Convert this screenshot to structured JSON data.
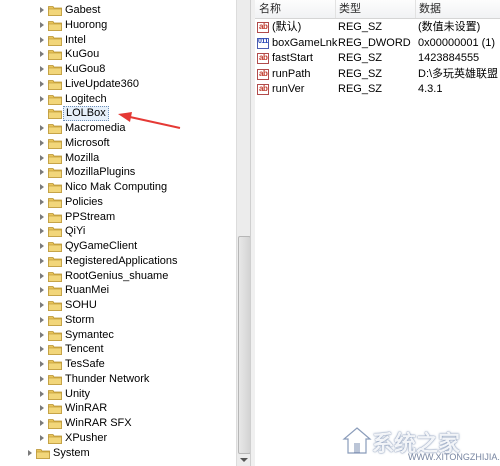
{
  "tree": {
    "items": [
      {
        "label": "Gabest",
        "indent": 1,
        "expander": true
      },
      {
        "label": "Huorong",
        "indent": 1,
        "expander": true
      },
      {
        "label": "Intel",
        "indent": 1,
        "expander": true
      },
      {
        "label": "KuGou",
        "indent": 1,
        "expander": true
      },
      {
        "label": "KuGou8",
        "indent": 1,
        "expander": true
      },
      {
        "label": "LiveUpdate360",
        "indent": 1,
        "expander": true
      },
      {
        "label": "Logitech",
        "indent": 1,
        "expander": true
      },
      {
        "label": "LOLBox",
        "indent": 1,
        "expander": false,
        "selected": true
      },
      {
        "label": "Macromedia",
        "indent": 1,
        "expander": true
      },
      {
        "label": "Microsoft",
        "indent": 1,
        "expander": true
      },
      {
        "label": "Mozilla",
        "indent": 1,
        "expander": true
      },
      {
        "label": "MozillaPlugins",
        "indent": 1,
        "expander": true
      },
      {
        "label": "Nico Mak Computing",
        "indent": 1,
        "expander": true
      },
      {
        "label": "Policies",
        "indent": 1,
        "expander": true
      },
      {
        "label": "PPStream",
        "indent": 1,
        "expander": true
      },
      {
        "label": "QiYi",
        "indent": 1,
        "expander": true
      },
      {
        "label": "QyGameClient",
        "indent": 1,
        "expander": true
      },
      {
        "label": "RegisteredApplications",
        "indent": 1,
        "expander": true
      },
      {
        "label": "RootGenius_shuame",
        "indent": 1,
        "expander": true
      },
      {
        "label": "RuanMei",
        "indent": 1,
        "expander": true
      },
      {
        "label": "SOHU",
        "indent": 1,
        "expander": true
      },
      {
        "label": "Storm",
        "indent": 1,
        "expander": true
      },
      {
        "label": "Symantec",
        "indent": 1,
        "expander": true
      },
      {
        "label": "Tencent",
        "indent": 1,
        "expander": true
      },
      {
        "label": "TesSafe",
        "indent": 1,
        "expander": true
      },
      {
        "label": "Thunder Network",
        "indent": 1,
        "expander": true
      },
      {
        "label": "Unity",
        "indent": 1,
        "expander": true
      },
      {
        "label": "WinRAR",
        "indent": 1,
        "expander": true
      },
      {
        "label": "WinRAR SFX",
        "indent": 1,
        "expander": true
      },
      {
        "label": "XPusher",
        "indent": 1,
        "expander": true
      },
      {
        "label": "System",
        "indent": 0,
        "expander": true
      }
    ]
  },
  "values": {
    "headers": {
      "name": "名称",
      "type": "类型",
      "data": "数据"
    },
    "rows": [
      {
        "icon": "string-value-icon",
        "name": "(默认)",
        "type": "REG_SZ",
        "data": "(数值未设置)"
      },
      {
        "icon": "binary-value-icon",
        "name": "boxGameLnk...",
        "type": "REG_DWORD",
        "data": "0x00000001 (1)"
      },
      {
        "icon": "string-value-icon",
        "name": "fastStart",
        "type": "REG_SZ",
        "data": "1423884555"
      },
      {
        "icon": "string-value-icon",
        "name": "runPath",
        "type": "REG_SZ",
        "data": "D:\\多玩英雄联盟盒子"
      },
      {
        "icon": "string-value-icon",
        "name": "runVer",
        "type": "REG_SZ",
        "data": "4.3.1"
      }
    ]
  },
  "colors": {
    "selection_border": "#6e8fb8",
    "annotation_arrow": "#e53935",
    "folder": "#e8c45a"
  },
  "watermark": {
    "text": "系统之家",
    "url": "WWW.XITONGZHIJIA.NET"
  }
}
